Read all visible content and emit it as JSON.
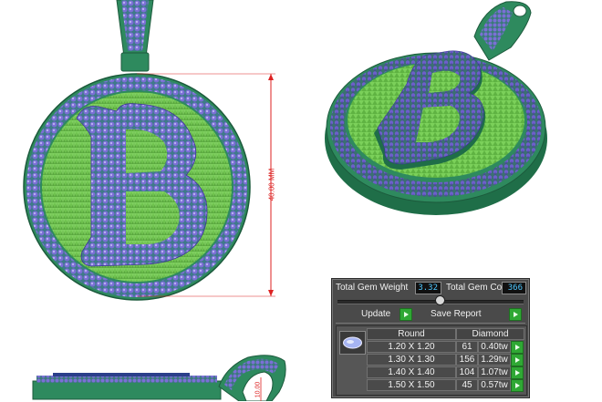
{
  "dimensions": {
    "height_label": "40.00 MM",
    "small_label": "10.00"
  },
  "gem_report": {
    "total_weight_label": "Total Gem Weight",
    "total_weight_value": "3.32",
    "total_count_label": "Total Gem Count",
    "total_count_value": "366",
    "update_label": "Update",
    "save_report_label": "Save Report",
    "columns": {
      "round": "Round",
      "diamond": "Diamond"
    },
    "rows": [
      {
        "size": "1.20 X 1.20",
        "count": "61",
        "weight": "0.40tw"
      },
      {
        "size": "1.30 X 1.30",
        "count": "156",
        "weight": "1.29tw"
      },
      {
        "size": "1.40 X 1.40",
        "count": "104",
        "weight": "1.07tw"
      },
      {
        "size": "1.50 X 1.50",
        "count": "45",
        "weight": "0.57tw"
      }
    ]
  },
  "colors": {
    "metal": "#2e8a5e",
    "gem": "#7b6fd6",
    "letter_fill": "#6fc24f",
    "dimension_line": "#dd2222",
    "panel_bg": "#4a4a4a",
    "value_text": "#4ec7ff",
    "green_button": "#2fa834"
  }
}
